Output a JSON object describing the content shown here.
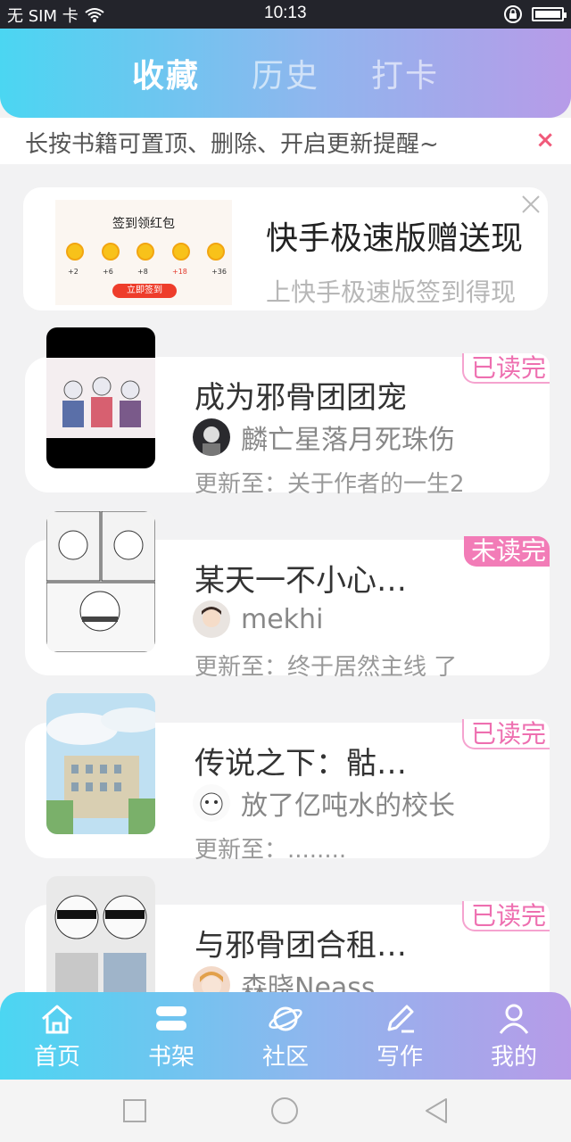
{
  "status_bar": {
    "carrier": "无 SIM 卡",
    "time": "10:13"
  },
  "tabs": [
    {
      "label": "收藏",
      "active": true
    },
    {
      "label": "历史",
      "active": false
    },
    {
      "label": "打卡",
      "active": false
    }
  ],
  "notice": {
    "text": "长按书籍可置顶、删除、开启更新提醒~",
    "close": "×"
  },
  "ad": {
    "title": "快手极速版赠送现",
    "subtitle": "上快手极速版签到得现",
    "image_title": "签到领红包",
    "rewards": [
      "+2",
      "+6",
      "+8",
      "+18",
      "+36"
    ],
    "image_button": "立即签到"
  },
  "books": [
    {
      "title": "成为邪骨团团宠",
      "author": "麟亡星落月死珠伤",
      "update": "更新至：关于作者的一生2",
      "badge": "已读完",
      "badge_type": "done"
    },
    {
      "title": "某天一不小心…",
      "author": "mekhi",
      "update": "更新至：终于居然主线 了",
      "badge": "未读完",
      "badge_type": "unread"
    },
    {
      "title": "传说之下：骷…",
      "author": "放了亿吨水的校长",
      "update": "更新至：........",
      "badge": "已读完",
      "badge_type": "done"
    },
    {
      "title": "与邪骨团合租…",
      "author": "森晓Neass",
      "update": "",
      "badge": "已读完",
      "badge_type": "done"
    }
  ],
  "bottom_nav": [
    {
      "label": "首页",
      "icon": "home-icon"
    },
    {
      "label": "书架",
      "icon": "bookshelf-icon"
    },
    {
      "label": "社区",
      "icon": "planet-icon"
    },
    {
      "label": "写作",
      "icon": "pen-icon"
    },
    {
      "label": "我的",
      "icon": "user-icon"
    }
  ],
  "colors": {
    "header_start": "#4bd6f2",
    "header_end": "#b79be8",
    "badge_pink": "#f27cb7",
    "close_red": "#f05a7a"
  }
}
